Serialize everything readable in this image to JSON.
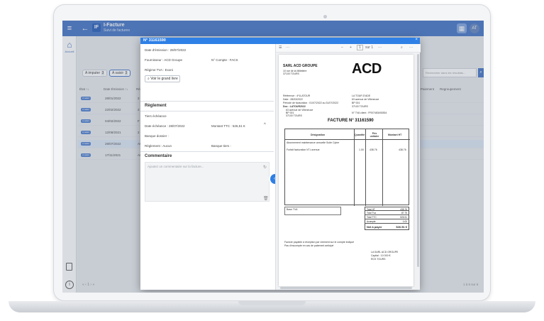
{
  "app": {
    "title": "I-Facture",
    "subtitle": "Suivi de factures",
    "logo": "IF",
    "avatar": "AT",
    "home_label": "Accueil",
    "chips": [
      {
        "label": "A imputer",
        "count": "3"
      },
      {
        "label": "A saisir",
        "count": "3"
      }
    ],
    "search_placeholder": "Rechercher dans les résultats...",
    "columns": {
      "etat": "État ↑↓",
      "date": "Date Émission ↑↓",
      "ref": "Ré",
      "paiement": "Paiement",
      "regroupement": "Regroupement"
    },
    "rows": [
      {
        "badge": "A saisir",
        "date": "28/01/2022",
        "ref": "2"
      },
      {
        "badge": "A saisir",
        "date": "22/02/2022",
        "ref": "2"
      },
      {
        "badge": "A saisir",
        "date": "04/02/2022",
        "ref": "F"
      },
      {
        "badge": "A saisir",
        "date": "12/08/2021",
        "ref": "2"
      },
      {
        "badge": "A saisir",
        "date": "28/07/2022",
        "ref": "AC"
      },
      {
        "badge": "A saisir",
        "date": "17/11/2021",
        "ref": "AC"
      }
    ],
    "pager": "« ‹ 1 › »",
    "count": "1 à 6 sur 6"
  },
  "modal": {
    "title": "N° 31161590",
    "close": "×",
    "fields": {
      "date_emission": "Date d'émission : 28/07/2022",
      "fournisseur": "Fournisseur : ACD Groupe",
      "compte": "N° Compte : FACS",
      "regime_tva": "Régime TVA : Exoni",
      "grand_livre": "Voir le grand livre"
    },
    "reglement": {
      "section": "Règlement",
      "tiers_echeance": "Tiers échéance",
      "date_echeance": "Date échéance : 28/07/2022",
      "montant": "Montant TTC : 526,51 €",
      "banque_dossier": "Banque dossier :",
      "reglement": "Règlement : Aucun",
      "banque_tiers": "Banque tiers :"
    },
    "commentaire": {
      "section": "Commentaire",
      "placeholder": "Ajoutez un commentaire sur la facture..."
    },
    "pdf": {
      "page_current": "1",
      "page_total": "sur 1",
      "company": "SARL ACD GROUPE",
      "company_addr1": "10 rue de la Milletière",
      "company_addr2": "37100 TOURS",
      "logo": "ACD",
      "ref": "Référence : 4*1LATOUR",
      "date": "Date : 28/03/2022",
      "periode": "Période de facturation : 01/07/2022 au 31/07/2022",
      "doc": "Doc : LATOUR2022",
      "client_addr1": "63 avenue de Villeneuve",
      "client_addr2": "BP 001",
      "client_addr3": "37100 TOURS",
      "dest_name": "LA TOUR D'ADE",
      "dest_addr1": "63 avenue de Villeneuve",
      "dest_addr2": "BP 001",
      "dest_addr3": "37100 TOURS",
      "tva_intra": "N° TVA client : FR07483492834",
      "invoice_title": "FACTURE N° 31161590",
      "th_designation": "Désignation",
      "th_quantite": "Quantité",
      "th_prix": "Prix unitaire",
      "th_montant": "Montant HT",
      "line1": "Abonnement maintenance annuelle Suite Cyber",
      "line2": "Forfait facturation N°1 avenue",
      "line2_qty": "1.00",
      "line2_pu": "438.76",
      "line2_ht": "438.76",
      "tot_ht_label": "Total HT",
      "tot_ht": "438.76",
      "tot_tva_label": "Total Tva",
      "tot_tva": "87.75",
      "tot_ttc_label": "Total TTC",
      "tot_ttc": "526.51",
      "acompte_label": "Acompte",
      "acompte": "0.00",
      "net_label": "Net à payer",
      "net": "526.51 €",
      "vat_label": "Base TVA",
      "footer1": "Facture payable à réception par virement sur le compte indiqué",
      "footer2": "Pas d'escompte en cas de paiement anticipé",
      "side_note1": "LA SARL ACD GROUPE",
      "side_note2": "Capital : 10 000 €",
      "side_note3": "RCS TOURS"
    }
  }
}
